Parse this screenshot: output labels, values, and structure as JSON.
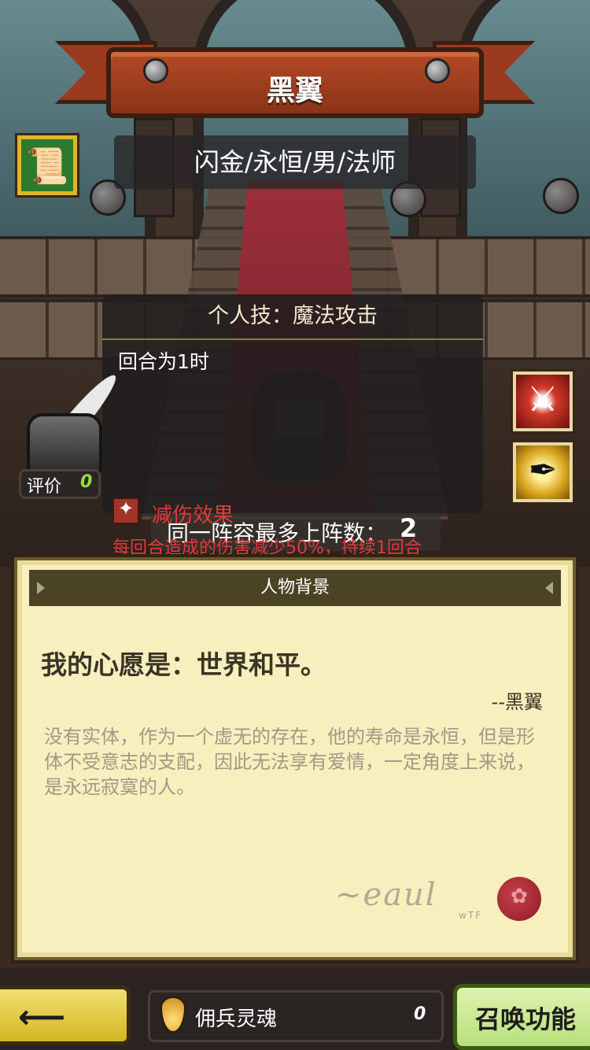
{
  "hero": {
    "name": "黑翼",
    "attributes": "闪金/永恒/男/法师"
  },
  "skill": {
    "title": "个人技：魔法攻击",
    "detail": "回合为1时"
  },
  "rating": {
    "label": "评价",
    "value": "0"
  },
  "effect": {
    "title": "减伤效果",
    "count_label": "同一阵容最多上阵数：",
    "count_value": "2",
    "description": "每回合造成的伤害减少50%，持续1回合"
  },
  "background_panel": {
    "header": "人物背景",
    "quote": "我的心愿是：世界和平。",
    "signature": "--黑翼",
    "bio": "没有实体，作为一个虚无的存在，他的寿命是永恒，但是形体不受意志的支配，因此无法享有爱情，一定角度上来说，是永远寂寞的人。",
    "stamp_text": "wTF"
  },
  "bottom": {
    "soul_label": "佣兵灵魂",
    "soul_value": "0",
    "summon_label": "召唤功能"
  },
  "icons": [
    "scroll-icon",
    "sword-slash-icon",
    "black-feather-icon",
    "inkwell-icon",
    "damage-reduction-icon",
    "soul-flame-icon",
    "back-arrow-icon",
    "wax-seal-icon"
  ],
  "colors": {
    "banner": "#b44a25",
    "effect_red": "#e03a3a",
    "rating_green": "#9cdd3c",
    "parchment": "#f7efbd",
    "summon_green": "#b6e07a",
    "back_yellow": "#d4b623"
  }
}
